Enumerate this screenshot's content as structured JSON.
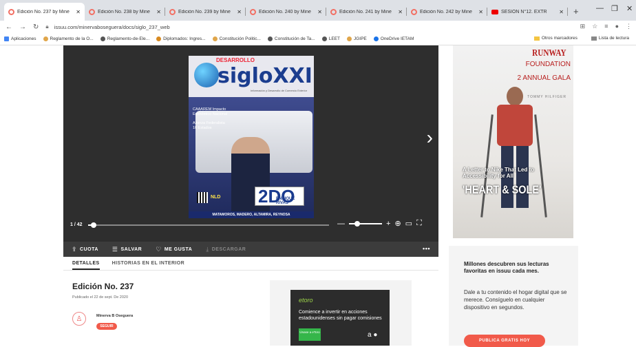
{
  "browser": {
    "tabs": [
      {
        "label": "Edición No. 237 by Mine",
        "active": true
      },
      {
        "label": "Edición No. 238 by Mine"
      },
      {
        "label": "Edición No. 239 by Mine"
      },
      {
        "label": "Edición No. 240 by Mine"
      },
      {
        "label": "Edición No. 241 by Mine"
      },
      {
        "label": "Edición No. 242 by Mine"
      },
      {
        "label": "SESIÓN N°12. EXTR"
      }
    ],
    "url": "issuu.com/minervaboseguera/docs/siglo_237_web",
    "bookmarks": [
      "Aplicaciones",
      "Reglamento de la O...",
      "Reglamento-de-Ele...",
      "Diplomados: Ingres...",
      "Constitución Politic...",
      "Constitución de Ta...",
      "LEET",
      "JGIPE",
      "OneDrive IETAM"
    ],
    "bookmarks_right": [
      "Otros marcadores",
      "Lista de lectura"
    ]
  },
  "cover": {
    "small_title": "DESARROLLO",
    "title": "sigloXXI",
    "subtitle": "Información y Desarrollo de Comercio Exterior",
    "bullet1": "CAAAREM Impacto Económico Nacional",
    "bullet2": "Alianza Federalista 10 Estados",
    "badge_number": "2DO",
    "badge_name": "ENRIQUE RIVAS",
    "logo": "NLD",
    "footer": "MATAMOROS, MADERO, ALTAMIRA, REYNOSA"
  },
  "viewer": {
    "page_indicator": "1 / 42",
    "progress": 0.024
  },
  "actions": {
    "quote": "CUOTA",
    "save": "SALVAR",
    "like": "ME GUSTA",
    "download": "DESCARGAR"
  },
  "detail_tabs": {
    "details": "DETALLES",
    "stories": "HISTORIAS EN EL INTERIOR"
  },
  "document": {
    "title": "Edición No. 237",
    "published": "Publicado el 22 de sept. De 2020",
    "author": "Minerva B Oseguera",
    "follow": "SEGUIR"
  },
  "ad": {
    "brand": "etoro",
    "text": "Comience a invertir en acciones estadounidenses sin pagar comisiones",
    "button": "Únase a eToro"
  },
  "side_ad": {
    "runway": "RUNWAY",
    "foundation": "FOUNDATION",
    "gala": "2 ANNUAL GALA",
    "sponsor": "TOMMY HILFIGER",
    "caption": "A Letter to Nike That Led to Accessibility for All",
    "headline": "'HEART & SOLE'"
  },
  "promo": {
    "heading": "Millones descubren sus lecturas favoritas en issuu cada mes.",
    "body": "Dale a tu contenido el hogar digital que se merece. Consíguelo en cualquier dispositivo en segundos.",
    "button": "PUBLICA GRATIS HOY"
  },
  "colors": {
    "accent": "#f15a4a",
    "dark": "#2e2e2e"
  }
}
